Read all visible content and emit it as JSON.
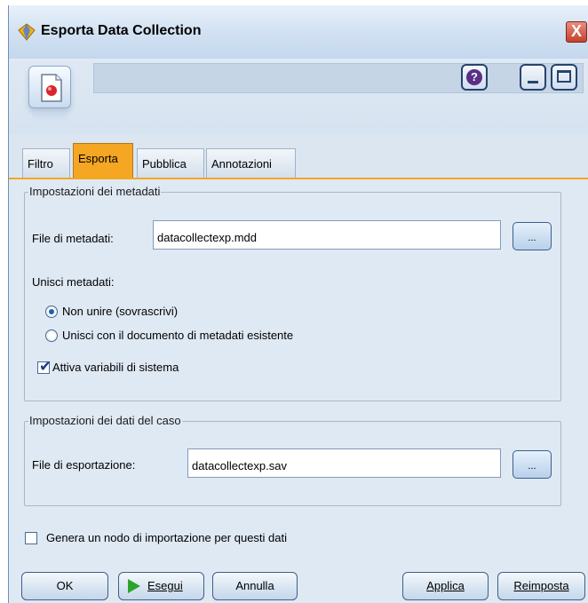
{
  "window": {
    "title": "Esporta Data Collection",
    "close_glyph": "X"
  },
  "header": {
    "help_glyph": "?"
  },
  "tabs": [
    {
      "label": "Filtro",
      "active": false
    },
    {
      "label": "Esporta",
      "active": true
    },
    {
      "label": "Pubblica",
      "active": false
    },
    {
      "label": "Annotazioni",
      "active": false
    }
  ],
  "metadata": {
    "group_title": "Impostazioni dei metadati",
    "file_label": "File di metadati:",
    "file_value": "datacollectexp.mdd",
    "browse_label": "...",
    "merge_label": "Unisci metadati:",
    "options": [
      {
        "label": "Non unire (sovrascrivi)",
        "checked": true
      },
      {
        "label": "Unisci con il documento di metadati esistente",
        "checked": false
      }
    ],
    "system_vars_label": "Attiva variabili di sistema",
    "system_vars_checked": true
  },
  "case_data": {
    "group_title": "Impostazioni dei dati del caso",
    "file_label": "File di esportazione:",
    "file_value": "datacollectexp.sav",
    "browse_label": "..."
  },
  "import_node": {
    "label": "Genera un nodo di importazione per questi dati",
    "checked": false
  },
  "buttons": {
    "ok": "OK",
    "run": "Esegui",
    "cancel": "Annulla",
    "apply": "Applica",
    "reset": "Reimposta"
  },
  "colors": {
    "accent_tab": "#f5a623",
    "window_bg": "#dde8f2"
  }
}
